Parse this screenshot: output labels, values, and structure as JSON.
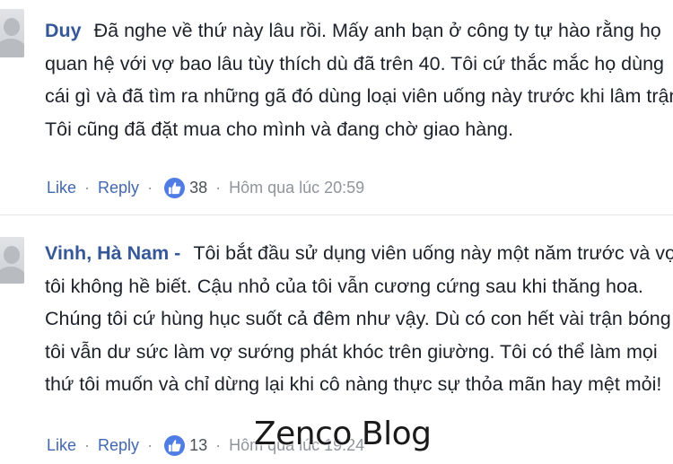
{
  "comments": [
    {
      "author": "Duy",
      "text": "Đã nghe về thứ này lâu rồi. Mấy anh bạn ở công ty tự hào rằng họ quan hệ với vợ bao lâu tùy thích dù đã trên 40. Tôi cứ thắc mắc họ dùng cái gì và đã tìm ra những gã đó dùng loại viên uống này trước khi lâm trận. Tôi cũng đã đặt mua cho mình và đang chờ giao hàng.",
      "like_label": "Like",
      "reply_label": "Reply",
      "separator": "·",
      "like_count": "38",
      "time": "Hôm qua lúc 20:59"
    },
    {
      "author": "Vinh, Hà Nam -",
      "text": "Tôi bắt đầu sử dụng viên uống này một năm trước và vợ tôi không hề biết. Cậu nhỏ của tôi vẫn cương cứng sau khi thăng hoa. Chúng tôi cứ hùng hục suốt cả đêm như vậy. Dù có con hết vài trận bóng tôi vẫn dư sức làm vợ sướng phát khóc trên giường. Tôi có thể làm mọi thứ tôi muốn và chỉ dừng lại khi cô nàng thực sự thỏa mãn hay mệt mỏi!",
      "like_label": "Like",
      "reply_label": "Reply",
      "separator": "·",
      "like_count": "13",
      "time": "Hôm qua lúc 19:24"
    }
  ],
  "watermark": "Zenco Blog",
  "colors": {
    "author": "#365899",
    "link": "#4267b2",
    "like_badge": "#4f7de3",
    "muted": "#90949c",
    "text": "#1d2129"
  },
  "icons": {
    "like_badge": "thumbs-up-icon",
    "avatar": "default-avatar-icon"
  }
}
